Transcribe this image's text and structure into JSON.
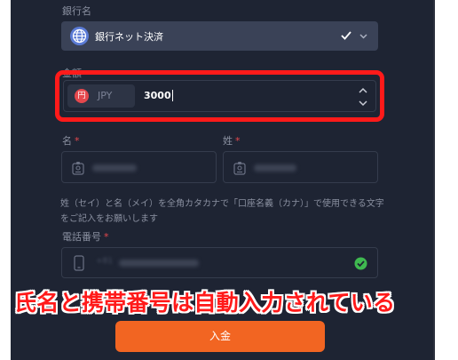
{
  "bank": {
    "label": "銀行名",
    "selected": "銀行ネット決済"
  },
  "amount": {
    "label": "金額",
    "currency": "JPY",
    "currency_symbol": "円",
    "value": "3000"
  },
  "first_name": {
    "label": "名",
    "required_mark": "*"
  },
  "last_name": {
    "label": "姓",
    "required_mark": "*"
  },
  "name_hint": "姓（セイ）と名（メイ）を全角カタカナで「口座名義（カナ）」で使用できる文字をご記入をお願いします",
  "phone": {
    "label": "電話番号",
    "required_mark": "*",
    "prefix": "+81"
  },
  "annotation": "氏名と携帯番号は自動入力されている",
  "submit": {
    "label": "入金"
  },
  "colors": {
    "panel": "#1e2433",
    "select_bg": "#3a4257",
    "highlight": "#ff1a1a",
    "accent": "#f26522",
    "success": "#3fb950"
  },
  "icons": [
    "globe-icon",
    "check-icon",
    "chevron-down-icon",
    "yen-icon",
    "stepper-icon",
    "id-card-icon",
    "phone-icon",
    "verified-icon"
  ]
}
